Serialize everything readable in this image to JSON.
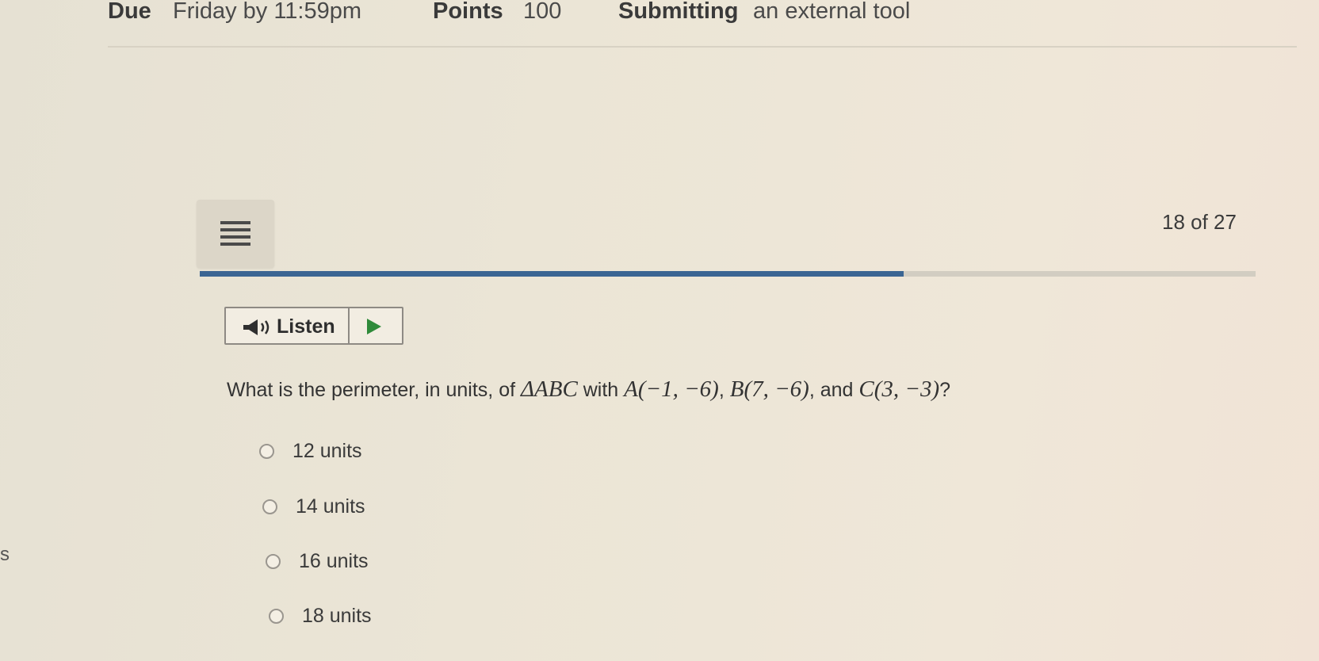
{
  "header": {
    "due_key": "Due",
    "due_value": "Friday by 11:59pm",
    "points_key": "Points",
    "points_value": "100",
    "submitting_key": "Submitting",
    "submitting_value": "an external tool"
  },
  "stray_left_char": "s",
  "quiz": {
    "counter": "18 of 27",
    "progress_fraction": 0.667,
    "listen_label": "Listen",
    "question_parts": {
      "p1": "What is the perimeter, in units, of ",
      "tri": "ΔABC",
      "p2": " with ",
      "a": "A(−1, −6)",
      "sep": ", ",
      "b": "B(7, −6)",
      "p3": ", and ",
      "c": "C(3, −3)",
      "end": "?"
    },
    "options": [
      "12 units",
      "14 units",
      "16 units",
      "18 units"
    ]
  },
  "colors": {
    "progress": "#3b6593",
    "play": "#2f8a3a"
  },
  "icons": [
    "menu-icon",
    "speaker-icon",
    "play-icon",
    "radio-icon"
  ]
}
